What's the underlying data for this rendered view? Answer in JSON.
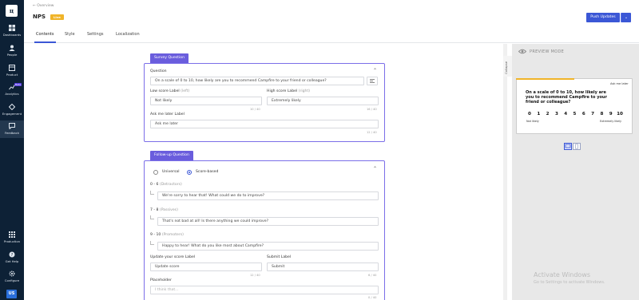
{
  "sidebar": {
    "logo": "ц",
    "items": [
      {
        "label": "Dashboards",
        "icon": "dashboard-icon"
      },
      {
        "label": "People",
        "icon": "people-icon"
      },
      {
        "label": "Product",
        "icon": "product-icon"
      },
      {
        "label": "Analytics",
        "icon": "analytics-icon",
        "badge": "Beta"
      },
      {
        "label": "Engagement",
        "icon": "engagement-icon"
      },
      {
        "label": "Feedback",
        "icon": "feedback-icon"
      }
    ],
    "bottom_items": [
      {
        "label": "Production",
        "icon": "grid-icon"
      },
      {
        "label": "Get Help",
        "icon": "help-icon"
      },
      {
        "label": "Configure",
        "icon": "gear-icon"
      }
    ],
    "avatar": "US",
    "accent": "#0d2136"
  },
  "header": {
    "back_label": "Overview",
    "title": "NPS",
    "status": "Live",
    "push_label": "Push Updates"
  },
  "tabs": [
    "Contents",
    "Style",
    "Settings",
    "Localization"
  ],
  "survey_question": {
    "tag": "Survey Question",
    "question_label": "Question",
    "question_value": "On a scale of 0 to 10, how likely are you to recommend Campfire to your friend or colleague?",
    "low_label": "Low score Label",
    "low_hint": "(left)",
    "low_value": "Not likely",
    "low_count": "10 / 40",
    "high_label": "High score Label",
    "high_hint": "(right)",
    "high_value": "Extremely likely",
    "high_count": "16 / 40",
    "later_label": "Ask me later Label",
    "later_value": "Ask me later",
    "later_count": "12 / 40"
  },
  "follow_up": {
    "tag": "Follow-up Question",
    "option_universal": "Universal",
    "option_score": "Score-based",
    "detractors_range": "0 - 6",
    "detractors_hint": "(Detractors)",
    "detractors_value": "We're sorry to hear that! What could we do to improve?",
    "passives_range": "7 - 8",
    "passives_hint": "(Passives)",
    "passives_value": "That's not bad at all! Is there anything we could improve?",
    "promoters_range": "9 - 10",
    "promoters_hint": "(Promoters)",
    "promoters_value": "Happy to hear! What do you like most about Campfire?",
    "update_label": "Update your score Label",
    "update_value": "Update score",
    "update_count": "12 / 40",
    "submit_label": "Submit Label",
    "submit_value": "Submit",
    "submit_count": "6 / 40",
    "placeholder_label": "Placeholder",
    "placeholder_value": "I think that...",
    "placeholder_count": "0 / 40"
  },
  "preview": {
    "collapse_label": "Collapse",
    "mode_label": "PREVIEW MODE",
    "ask_later": "Ask me later",
    "question": "On a scale of 0 to 10, how likely are you to recommend Campfire to your friend or colleague?",
    "scores": [
      "0",
      "1",
      "2",
      "3",
      "4",
      "5",
      "6",
      "7",
      "8",
      "9",
      "10"
    ],
    "low": "Not likely",
    "high": "Extremely likely"
  },
  "watermark": {
    "line1": "Activate Windows",
    "line2": "Go to Settings to activate Windows."
  }
}
